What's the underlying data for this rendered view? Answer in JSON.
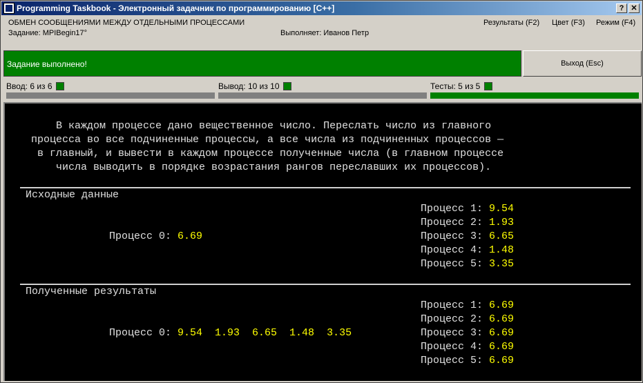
{
  "window": {
    "title": "Programming Taskbook - Электронный задачник по программированию [C++]",
    "help_label": "?",
    "close_label": "✕"
  },
  "header": {
    "group_title": "ОБМЕН СООБЩЕНИЯМИ МЕЖДУ ОТДЕЛЬНЫМИ ПРОЦЕССАМИ",
    "task": "Задание: MPIBegin17°",
    "executor": "Выполняет: Иванов Петр",
    "menu": [
      "Результаты (F2)",
      "Цвет (F3)",
      "Режим (F4)"
    ]
  },
  "status": {
    "message": "Задание выполнено!",
    "color": "#008000",
    "exit_label": "Выход (Esc)"
  },
  "counters": [
    {
      "label": "Ввод: 6 из 6",
      "progress": 1.0
    },
    {
      "label": "Вывод: 10 из 10",
      "progress": 1.0
    },
    {
      "label": "Тесты: 5 из 5",
      "progress": 1.0
    }
  ],
  "console": {
    "description": [
      "В каждом процессе дано вещественное число. Переслать число из главного",
      "процесса во все подчиненные процессы, а все числа из подчиненных процессов —",
      "в главный, и вывести в каждом процессе полученные числа (в главном процессе",
      "числа выводить в порядке возрастания рангов переславших их процессов)."
    ],
    "input": {
      "title": "Исходные данные",
      "main": {
        "label": "Процесс 0:",
        "value": "6.69"
      },
      "others": [
        {
          "label": "Процесс 1:",
          "value": "9.54"
        },
        {
          "label": "Процесс 2:",
          "value": "1.93"
        },
        {
          "label": "Процесс 3:",
          "value": "6.65"
        },
        {
          "label": "Процесс 4:",
          "value": "1.48"
        },
        {
          "label": "Процесс 5:",
          "value": "3.35"
        }
      ]
    },
    "results": {
      "title": "Полученные результаты",
      "main": {
        "label": "Процесс 0:",
        "value": "9.54  1.93  6.65  1.48  3.35"
      },
      "others": [
        {
          "label": "Процесс 1:",
          "value": "6.69"
        },
        {
          "label": "Процесс 2:",
          "value": "6.69"
        },
        {
          "label": "Процесс 3:",
          "value": "6.69"
        },
        {
          "label": "Процесс 4:",
          "value": "6.69"
        },
        {
          "label": "Процесс 5:",
          "value": "6.69"
        }
      ]
    }
  }
}
